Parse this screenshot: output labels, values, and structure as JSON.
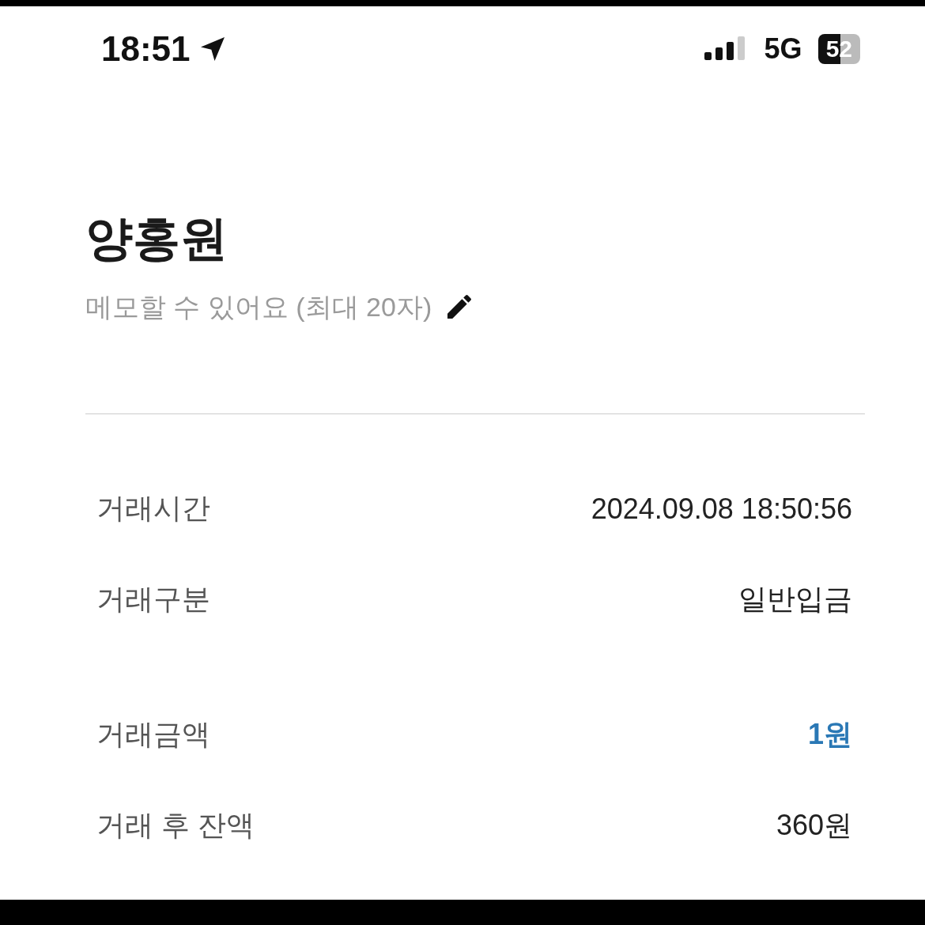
{
  "status_bar": {
    "time": "18:51",
    "network": "5G",
    "battery": "52"
  },
  "title": "양홍원",
  "memo": {
    "placeholder": "메모할 수 있어요 (최대 20자)"
  },
  "rows": [
    {
      "label": "거래시간",
      "value": "2024.09.08 18:50:56",
      "kind": "plain"
    },
    {
      "label": "거래구분",
      "value": "일반입금",
      "kind": "plain"
    },
    {
      "label": "거래금액",
      "value": "1원",
      "kind": "amount"
    },
    {
      "label": "거래 후 잔액",
      "value": "360원",
      "kind": "plain"
    }
  ]
}
